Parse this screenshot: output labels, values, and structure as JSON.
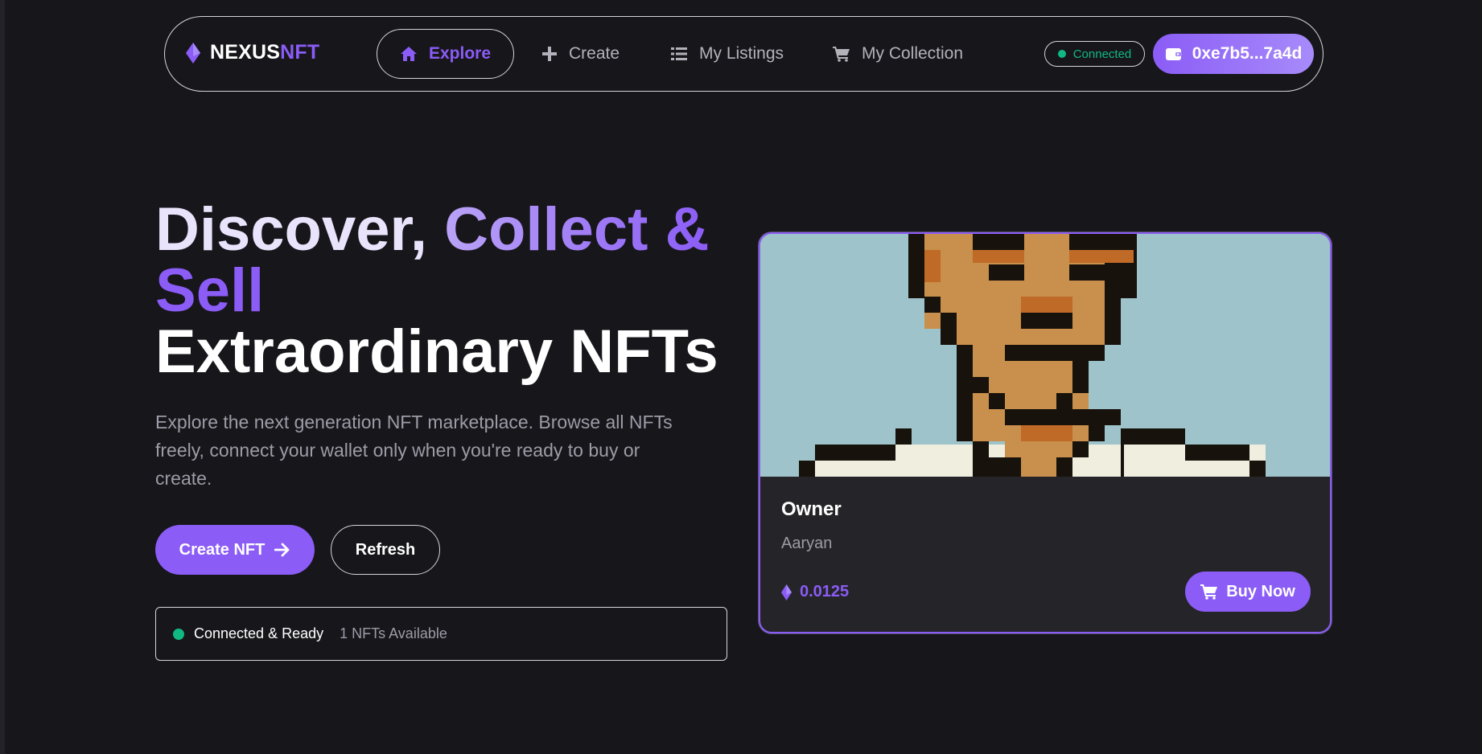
{
  "nav": {
    "logo": {
      "brand_primary": "NEXUS",
      "brand_accent": "NFT",
      "icon": "ethereum-diamond-icon"
    },
    "items": [
      {
        "label": "Explore",
        "icon": "home-icon",
        "active": true
      },
      {
        "label": "Create",
        "icon": "plus-icon"
      },
      {
        "label": "My Listings",
        "icon": "list-icon"
      },
      {
        "label": "My Collection",
        "icon": "cart-icon"
      }
    ],
    "connection_status": "Connected",
    "wallet_address": "0xe7b5...7a4d"
  },
  "hero": {
    "title_part1": "Discover, ",
    "title_part2": "Collect &",
    "title_part3": "Sell",
    "title_part4": "Extraordinary NFTs",
    "description": "Explore the next generation NFT marketplace. Browse all NFTs freely, connect your wallet only when you're ready to buy or create.",
    "create_button": "Create NFT",
    "refresh_button": "Refresh",
    "status_text": "Connected & Ready",
    "nft_count_text": "1 NFTs Available"
  },
  "card": {
    "owner_label": "Owner",
    "owner_name": "Aaryan",
    "price": "0.0125",
    "buy_button": "Buy Now"
  },
  "colors": {
    "background": "#17161b",
    "accent": "#8b5cf6",
    "accent_light": "#a78bfa",
    "success": "#10b981",
    "card_bg": "#252529",
    "image_bg": "#9ec3ca"
  }
}
